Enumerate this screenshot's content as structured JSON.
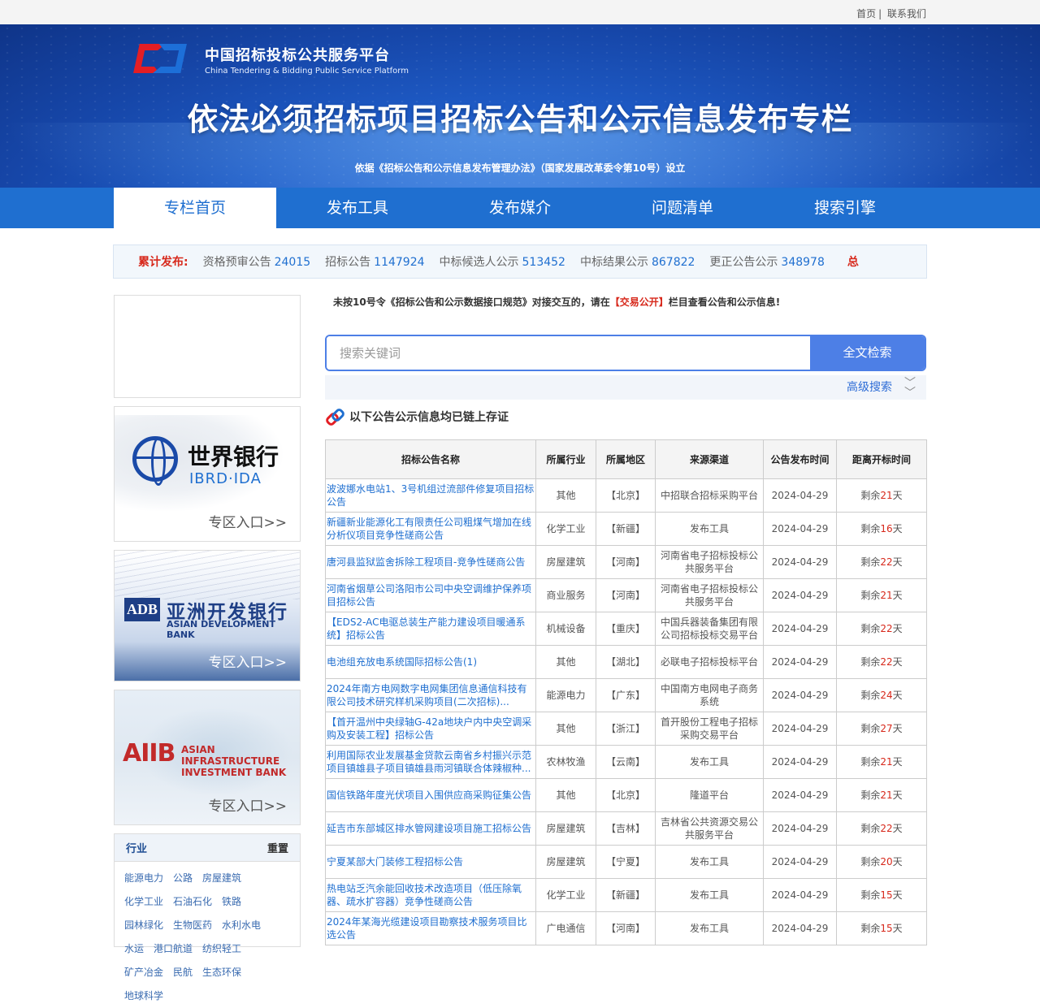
{
  "topbar": {
    "home": "首页",
    "sep": "|",
    "contact": "联系我们"
  },
  "logo": {
    "zh": "中国招标投标公共服务平台",
    "en": "China Tendering & Bidding Public Service Platform"
  },
  "banner": {
    "title": "依法必须招标项目招标公告和公示信息发布专栏",
    "subtitle": "依据《招标公告和公示信息发布管理办法》（国家发展改革委令第10号）设立"
  },
  "nav": [
    {
      "label": "专栏首页",
      "active": true
    },
    {
      "label": "发布工具"
    },
    {
      "label": "发布媒介"
    },
    {
      "label": "问题清单"
    },
    {
      "label": "搜索引擎"
    }
  ],
  "stats": {
    "lead": "累计发布:",
    "items": [
      {
        "label": "资格预审公告",
        "value": "24015"
      },
      {
        "label": "招标公告",
        "value": "1147924"
      },
      {
        "label": "中标候选人公示",
        "value": "513452"
      },
      {
        "label": "中标结果公示",
        "value": "867822"
      },
      {
        "label": "更正公告公示",
        "value": "348978"
      }
    ],
    "tail": "总"
  },
  "zones": {
    "wb": {
      "zh": "世界银行",
      "en": "IBRD·IDA",
      "entry": "专区入口>>"
    },
    "adb": {
      "badge": "ADB",
      "zh": "亚洲开发银行",
      "en": "ASIAN DEVELOPMENT BANK",
      "entry": "专区入口>>"
    },
    "aiib": {
      "abbr": "AIIB",
      "en1": "ASIAN INFRASTRUCTURE",
      "en2": "INVESTMENT BANK",
      "entry": "专区入口>>"
    }
  },
  "industry": {
    "title": "行业",
    "reset": "重置",
    "items": [
      "能源电力",
      "公路",
      "房屋建筑",
      "化学工业",
      "石油石化",
      "铁路",
      "园林绿化",
      "生物医药",
      "水利水电",
      "水运",
      "港口航道",
      "纺织轻工",
      "矿产冶金",
      "民航",
      "生态环保",
      "地球科学"
    ]
  },
  "notice": {
    "pre": "未按10号令《招标公告和公示数据接口规范》对接交互的，请在",
    "em": "【交易公开】",
    "post": "栏目查看公告和公示信息!"
  },
  "search": {
    "placeholder": "搜索关键词",
    "button": "全文检索",
    "advanced": "高级搜索"
  },
  "chain_note": "以下公告公示信息均已链上存证",
  "table": {
    "headers": [
      "招标公告名称",
      "所属行业",
      "所属地区",
      "来源渠道",
      "公告发布时间",
      "距离开标时间"
    ],
    "rows": [
      {
        "name": "波波娜水电站1、3号机组过流部件修复项目招标公告",
        "industry": "其他",
        "region": "【北京】",
        "source": "中招联合招标采购平台",
        "date": "2024-04-29",
        "pre": "剩余",
        "days": "21",
        "suf": "天"
      },
      {
        "name": "新疆新业能源化工有限责任公司粗煤气增加在线分析仪项目竞争性磋商公告",
        "industry": "化学工业",
        "region": "【新疆】",
        "source": "发布工具",
        "date": "2024-04-29",
        "pre": "剩余",
        "days": "16",
        "suf": "天"
      },
      {
        "name": "唐河县监狱监舍拆除工程项目-竞争性磋商公告",
        "industry": "房屋建筑",
        "region": "【河南】",
        "source": "河南省电子招标投标公共服务平台",
        "date": "2024-04-29",
        "pre": "剩余",
        "days": "22",
        "suf": "天"
      },
      {
        "name": "河南省烟草公司洛阳市公司中央空调维护保养项目招标公告",
        "industry": "商业服务",
        "region": "【河南】",
        "source": "河南省电子招标投标公共服务平台",
        "date": "2024-04-29",
        "pre": "剩余",
        "days": "21",
        "suf": "天"
      },
      {
        "name": "【EDS2-AC电驱总装生产能力建设项目暖通系统】招标公告",
        "industry": "机械设备",
        "region": "【重庆】",
        "source": "中国兵器装备集团有限公司招标投标交易平台",
        "date": "2024-04-29",
        "pre": "剩余",
        "days": "22",
        "suf": "天"
      },
      {
        "name": "电池组充放电系统国际招标公告(1)",
        "industry": "其他",
        "region": "【湖北】",
        "source": "必联电子招标投标平台",
        "date": "2024-04-29",
        "pre": "剩余",
        "days": "22",
        "suf": "天"
      },
      {
        "name": "2024年南方电网数字电网集团信息通信科技有限公司技术研究样机采购项目(二次招标)...",
        "industry": "能源电力",
        "region": "【广东】",
        "source": "中国南方电网电子商务系统",
        "date": "2024-04-29",
        "pre": "剩余",
        "days": "24",
        "suf": "天"
      },
      {
        "name": "【首开温州中央绿轴G-42a地块户内中央空调采购及安装工程】招标公告",
        "industry": "其他",
        "region": "【浙江】",
        "source": "首开股份工程电子招标采购交易平台",
        "date": "2024-04-29",
        "pre": "剩余",
        "days": "27",
        "suf": "天"
      },
      {
        "name": "利用国际农业发展基金贷款云南省乡村振兴示范项目镇雄县子项目镇雄县雨河镇联合体辣椒种...",
        "industry": "农林牧渔",
        "region": "【云南】",
        "source": "发布工具",
        "date": "2024-04-29",
        "pre": "剩余",
        "days": "21",
        "suf": "天"
      },
      {
        "name": "国信铁路年度光伏项目入围供应商采购征集公告",
        "industry": "其他",
        "region": "【北京】",
        "source": "隆道平台",
        "date": "2024-04-29",
        "pre": "剩余",
        "days": "21",
        "suf": "天"
      },
      {
        "name": "延吉市东部城区排水管网建设项目施工招标公告",
        "industry": "房屋建筑",
        "region": "【吉林】",
        "source": "吉林省公共资源交易公共服务平台",
        "date": "2024-04-29",
        "pre": "剩余",
        "days": "22",
        "suf": "天"
      },
      {
        "name": "宁夏某部大门装修工程招标公告",
        "industry": "房屋建筑",
        "region": "【宁夏】",
        "source": "发布工具",
        "date": "2024-04-29",
        "pre": "剩余",
        "days": "20",
        "suf": "天"
      },
      {
        "name": "热电站乏汽余能回收技术改造项目（低压除氧器、疏水扩容器）竞争性磋商公告",
        "industry": "化学工业",
        "region": "【新疆】",
        "source": "发布工具",
        "date": "2024-04-29",
        "pre": "剩余",
        "days": "15",
        "suf": "天"
      },
      {
        "name": "2024年某海光缆建设项目勘察技术服务项目比选公告",
        "industry": "广电通信",
        "region": "【河南】",
        "source": "发布工具",
        "date": "2024-04-29",
        "pre": "剩余",
        "days": "15",
        "suf": "天"
      }
    ]
  }
}
